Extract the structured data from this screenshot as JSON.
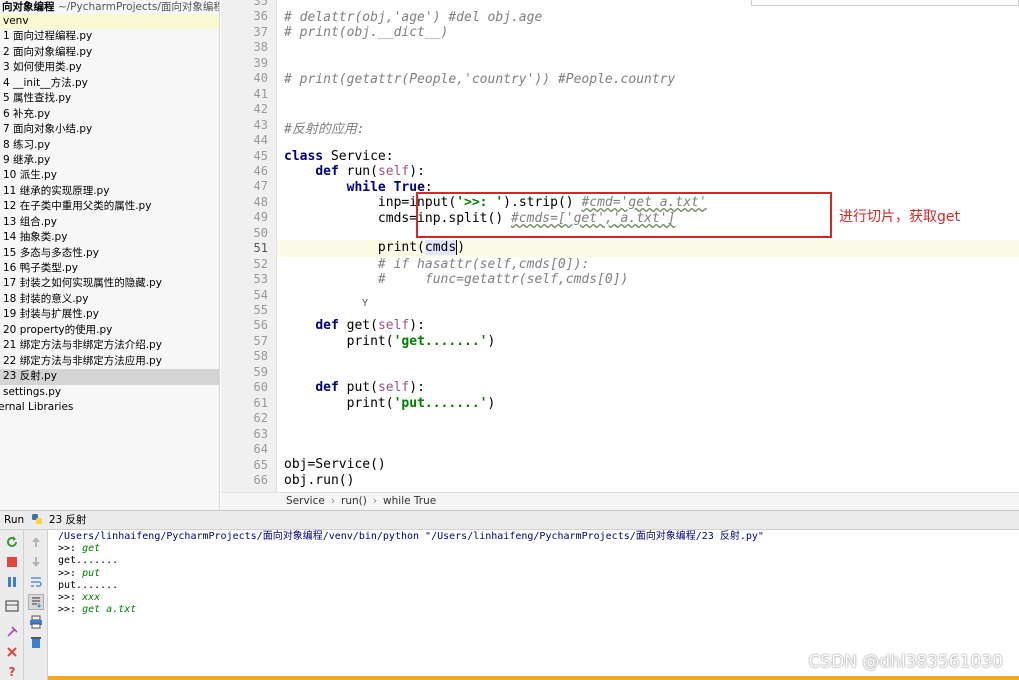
{
  "project": {
    "root_name": "向对象编程",
    "root_path": "~/PycharmProjects/面向对象编程",
    "items": [
      "venv",
      "1 面向过程编程.py",
      "2 面向对象编程.py",
      "3 如何使用类.py",
      "4 __init__方法.py",
      "5 属性查找.py",
      "6 补充.py",
      "7 面向对象小结.py",
      "8 练习.py",
      "9 继承.py",
      "10 派生.py",
      "11 继承的实现原理.py",
      "12 在子类中重用父类的属性.py",
      "13 组合.py",
      "14 抽象类.py",
      "15 多态与多态性.py",
      "16 鸭子类型.py",
      "17 封装之如何实现属性的隐藏.py",
      "18 封装的意义.py",
      "19 封装与扩展性.py",
      "20 property的使用.py",
      "21 绑定方法与非绑定方法介绍.py",
      "22 绑定方法与非绑定方法应用.py",
      "23 反射.py",
      "settings.py",
      "ternal Libraries"
    ],
    "selected_index": 23
  },
  "editor": {
    "line_numbers": [
      "35",
      "36",
      "37",
      "38",
      "39",
      "40",
      "41",
      "42",
      "43",
      "44",
      "45",
      "46",
      "47",
      "48",
      "49",
      "50",
      "51",
      "52",
      "53",
      "54",
      "55",
      "56",
      "57",
      "58",
      "59",
      "60",
      "61",
      "62",
      "63",
      "64",
      "65",
      "66"
    ],
    "current_line": "51",
    "lines": {
      "l36": "# delattr(obj,'age') #del obj.age",
      "l37": "# print(obj.__dict__)",
      "l40": "# print(getattr(People,'country')) #People.country",
      "l43": "#反射的应用:",
      "l45_kw": "class",
      "l45_rest": " Service:",
      "l46_kw": "def",
      "l46_name": " run(",
      "l46_self": "self",
      "l46_end": "):",
      "l47_kw": "while True",
      "l47_end": ":",
      "l48_a": "inp=input(",
      "l48_str": "'>>: '",
      "l48_b": ").strip() ",
      "l48_cmt": "#cmd='get a.txt'",
      "l49_a": "cmds=inp.split() ",
      "l49_cmt": "#cmds=['get','a.txt']",
      "l51_a": "print(",
      "l51_var": "cmds",
      "l51_b": ")",
      "l52": "# if hasattr(self,cmds[0]):",
      "l53": "#     func=getattr(self,cmds[0])",
      "l54": "Y",
      "l56_kw": "def",
      "l56_name": " get(",
      "l56_self": "self",
      "l56_end": "):",
      "l57_a": "print(",
      "l57_str": "'get.......'",
      "l57_b": ")",
      "l60_kw": "def",
      "l60_name": " put(",
      "l60_self": "self",
      "l60_end": "):",
      "l61_a": "print(",
      "l61_str": "'put.......'",
      "l61_b": ")",
      "l65": "obj=Service()",
      "l66": "obj.run()"
    },
    "annotation": "进行切片，获取get",
    "annotation_color": "#d62728"
  },
  "breadcrumbs": [
    "Service",
    "run()",
    "while True"
  ],
  "run_panel": {
    "label": "Run",
    "config_name": "23 反射",
    "console": [
      {
        "text": "/Users/linhaifeng/PycharmProjects/面向对象编程/venv/bin/python \"/Users/linhaifeng/PycharmProjects/面向对象编程/23 反射.py\"",
        "kind": "cmd"
      },
      {
        "prompt": ">>: ",
        "input": "get",
        "kind": "input"
      },
      {
        "text": "get.......",
        "kind": "out"
      },
      {
        "prompt": ">>: ",
        "input": "put",
        "kind": "input"
      },
      {
        "text": "put.......",
        "kind": "out"
      },
      {
        "prompt": ">>: ",
        "input": "xxx",
        "kind": "input"
      },
      {
        "prompt": ">>: ",
        "input": "get a.txt",
        "kind": "input"
      }
    ]
  },
  "watermark": "CSDN @dhl383561030",
  "colors": {
    "keyword": "#000080",
    "string": "#008000",
    "comment": "#808080",
    "self": "#94558d",
    "annotation": "#d62728"
  }
}
